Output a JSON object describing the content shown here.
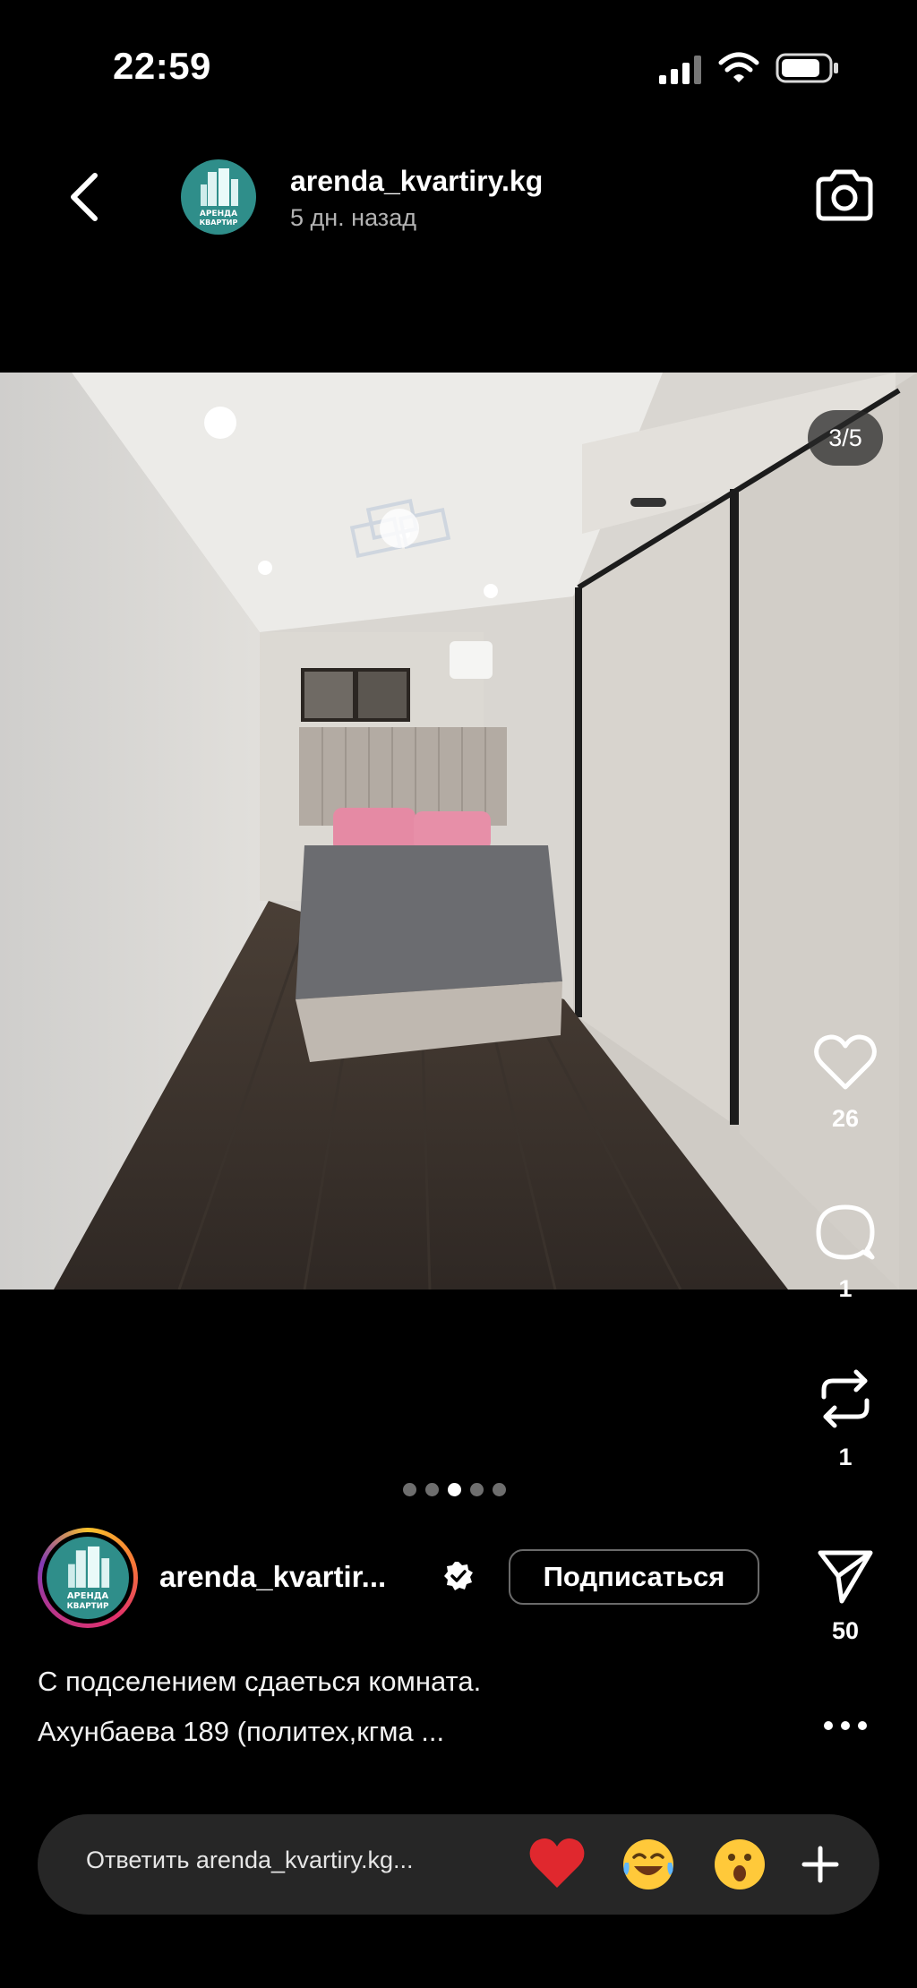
{
  "status_bar": {
    "time": "22:59"
  },
  "header": {
    "username": "arenda_kvartiry.kg",
    "posted_ago": "5 дн. назад",
    "avatar_text_line1": "АРЕНДА",
    "avatar_text_line2": "КВАРТИР"
  },
  "media": {
    "counter": "3/5",
    "dots_total": 5,
    "dots_active_index": 2
  },
  "actions": {
    "likes": "26",
    "comments": "1",
    "reposts": "1",
    "shares": "50"
  },
  "author": {
    "username": "arenda_kvartir...",
    "follow_label": "Подписаться"
  },
  "caption": {
    "line1": "С подселением сдаеться комната.",
    "line2": "Ахунбаева 189 (политех,кгма ..."
  },
  "reply": {
    "placeholder": "Ответить arenda_kvartiry.kg...",
    "reactions": [
      "❤️",
      "😂",
      "😮"
    ]
  },
  "colors": {
    "avatar_bg": "#2f8e8a",
    "background": "#000000",
    "reply_bar": "#262626"
  }
}
